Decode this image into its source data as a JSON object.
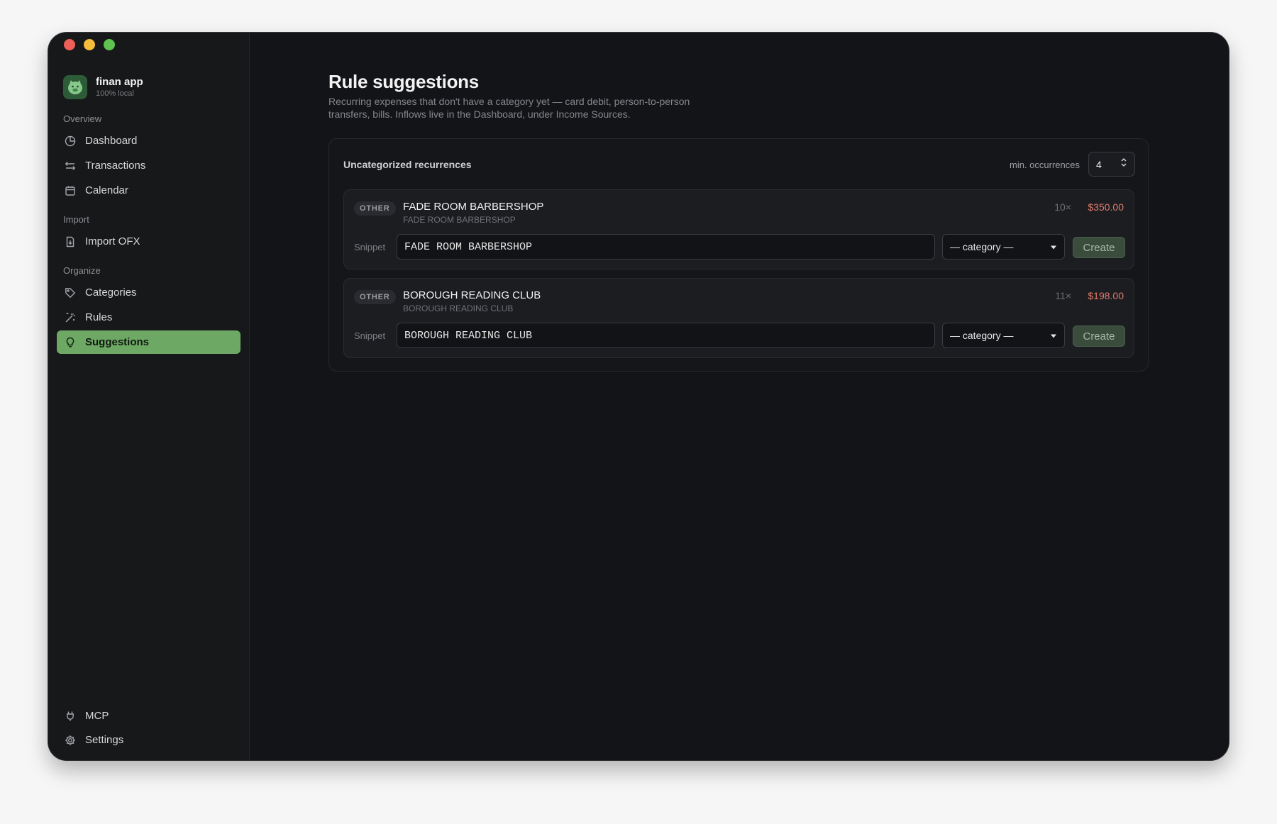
{
  "app": {
    "name": "finan app",
    "subtitle": "100% local"
  },
  "sidebar": {
    "sections": [
      {
        "label": "Overview",
        "items": [
          {
            "label": "Dashboard",
            "icon": "pie-chart-icon"
          },
          {
            "label": "Transactions",
            "icon": "swap-arrows-icon"
          },
          {
            "label": "Calendar",
            "icon": "calendar-icon"
          }
        ]
      },
      {
        "label": "Import",
        "items": [
          {
            "label": "Import OFX",
            "icon": "file-download-icon"
          }
        ]
      },
      {
        "label": "Organize",
        "items": [
          {
            "label": "Categories",
            "icon": "tag-icon"
          },
          {
            "label": "Rules",
            "icon": "magic-wand-icon"
          },
          {
            "label": "Suggestions",
            "icon": "lightbulb-icon",
            "active": true
          }
        ]
      }
    ],
    "footer": [
      {
        "label": "MCP",
        "icon": "plug-icon"
      },
      {
        "label": "Settings",
        "icon": "gear-icon"
      }
    ]
  },
  "main": {
    "title": "Rule suggestions",
    "description": "Recurring expenses that don't have a category yet — card debit, person-to-person transfers, bills. Inflows live in the Dashboard, under Income Sources.",
    "card": {
      "title": "Uncategorized recurrences",
      "min_occurrences_label": "min. occurrences",
      "min_occurrences_value": "4",
      "recurrences": [
        {
          "tag": "OTHER",
          "name": "FADE ROOM BARBERSHOP",
          "sub": "FADE ROOM BARBERSHOP",
          "count": "10×",
          "amount": "$350.00",
          "snippet_label": "Snippet",
          "snippet_value": "FADE ROOM BARBERSHOP",
          "category_placeholder": "— category —",
          "create_label": "Create"
        },
        {
          "tag": "OTHER",
          "name": "BOROUGH READING CLUB",
          "sub": "BOROUGH READING CLUB",
          "count": "11×",
          "amount": "$198.00",
          "snippet_label": "Snippet",
          "snippet_value": "BOROUGH READING CLUB",
          "category_placeholder": "— category —",
          "create_label": "Create"
        }
      ]
    }
  },
  "colors": {
    "accent": "#6ea865",
    "amount": "#e07b6a",
    "background": "#131417"
  }
}
